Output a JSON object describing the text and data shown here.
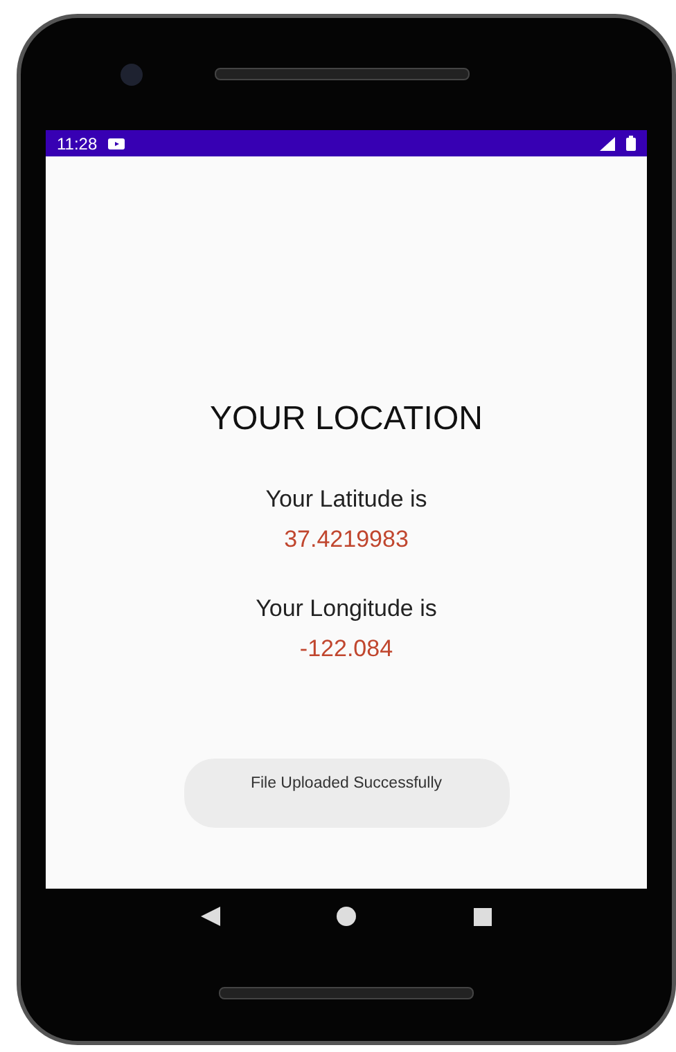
{
  "status_bar": {
    "time": "11:28"
  },
  "title": "YOUR LOCATION",
  "readings": [
    {
      "label": "Your Latitude is",
      "value": "37.4219983"
    },
    {
      "label": "Your Longitude is",
      "value": "-122.084"
    }
  ],
  "toast": "File Uploaded Successfully"
}
